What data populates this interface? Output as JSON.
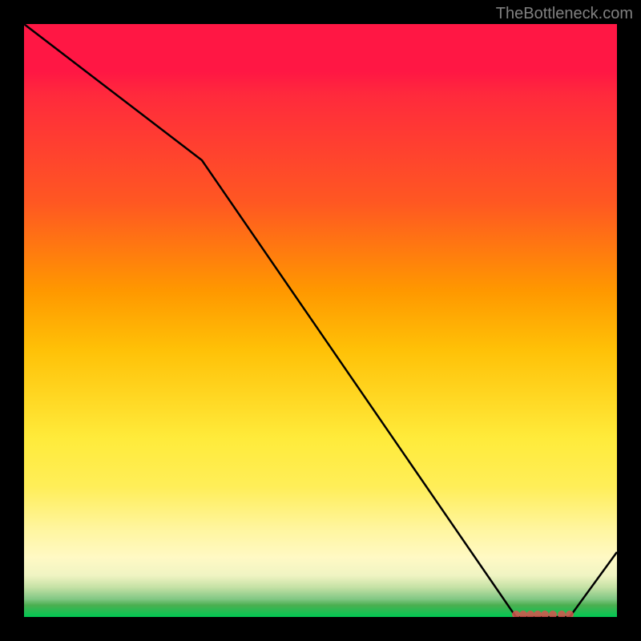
{
  "watermark": "TheBottleneck.com",
  "chart_data": {
    "type": "line",
    "x": [
      0,
      0.3,
      0.83,
      0.92,
      1.0
    ],
    "values": [
      1.0,
      0.77,
      0.0,
      0.0,
      0.11
    ],
    "title": "",
    "xlabel": "",
    "ylabel": "",
    "xlim": [
      0,
      1
    ],
    "ylim": [
      0,
      1
    ],
    "markers": {
      "x_range": [
        0.83,
        0.92
      ],
      "y": 0.0,
      "color": "#e05a5a"
    },
    "background": "red-yellow-green vertical gradient",
    "line_color": "#000000"
  }
}
